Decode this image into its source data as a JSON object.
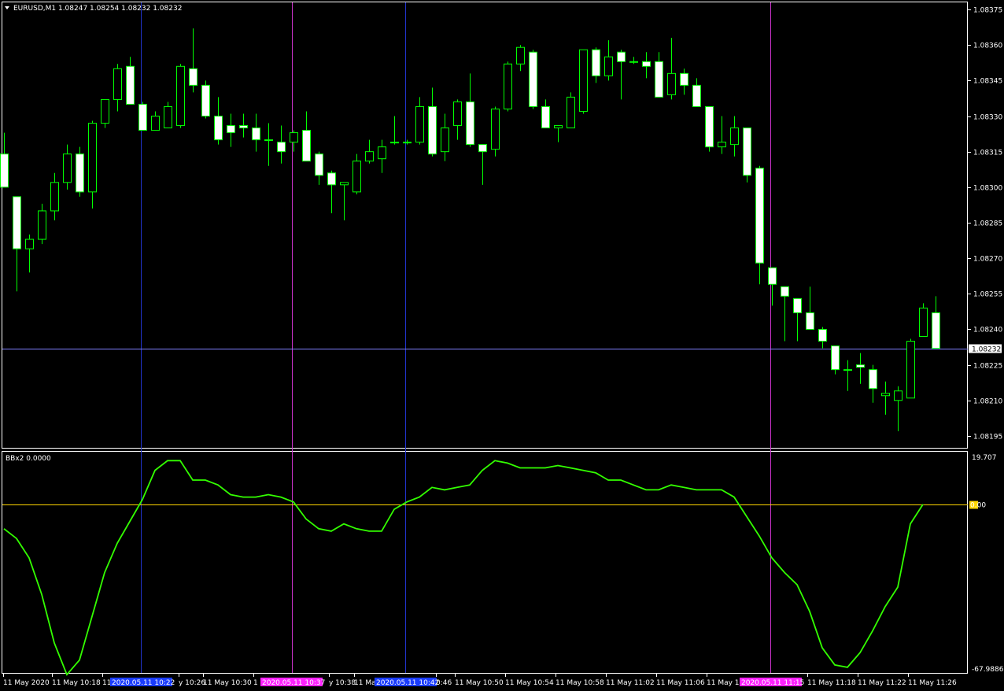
{
  "symbol_header": "EURUSD,M1  1.08247 1.08254 1.08232 1.08232",
  "indicator_header": "BBx2 0.0000",
  "current_price_label": "1.08232",
  "colors": {
    "background": "#000000",
    "frame": "#ffffff",
    "bull_candle": "#00ff00",
    "bear_candle_fill": "#ffffff",
    "indicator_line": "#33ff00",
    "zero_line": "#ffd700",
    "price_line": "#8080ff",
    "vline_blue": "#2233cc",
    "vline_magenta": "#cc33cc",
    "marker_blue": "#1a3cff",
    "marker_magenta": "#ff22ff",
    "zero_badge": "#ffd700"
  },
  "chart_data": [
    {
      "type": "candlestick",
      "title": "EURUSD,M1",
      "ylim": [
        1.0819,
        1.08378
      ],
      "y_ticks": [
        "1.08375",
        "1.08360",
        "1.08345",
        "1.08330",
        "1.08315",
        "1.08300",
        "1.08285",
        "1.08270",
        "1.08255",
        "1.08240",
        "1.08225",
        "1.08210",
        "1.08195"
      ],
      "last_price": 1.08232,
      "candles": [
        {
          "o": 1.08314,
          "h": 1.08323,
          "l": 1.08301,
          "c": 1.083
        },
        {
          "o": 1.08296,
          "h": 1.08296,
          "l": 1.08256,
          "c": 1.08274
        },
        {
          "o": 1.08274,
          "h": 1.0828,
          "l": 1.08264,
          "c": 1.08278
        },
        {
          "o": 1.08278,
          "h": 1.08293,
          "l": 1.08276,
          "c": 1.0829
        },
        {
          "o": 1.0829,
          "h": 1.08306,
          "l": 1.08286,
          "c": 1.08302
        },
        {
          "o": 1.08302,
          "h": 1.08318,
          "l": 1.08299,
          "c": 1.08314
        },
        {
          "o": 1.08314,
          "h": 1.08317,
          "l": 1.08296,
          "c": 1.08298
        },
        {
          "o": 1.08298,
          "h": 1.08328,
          "l": 1.08291,
          "c": 1.08327
        },
        {
          "o": 1.08327,
          "h": 1.08337,
          "l": 1.08325,
          "c": 1.08337
        },
        {
          "o": 1.08337,
          "h": 1.08352,
          "l": 1.08332,
          "c": 1.0835
        },
        {
          "o": 1.08351,
          "h": 1.08355,
          "l": 1.08335,
          "c": 1.08335
        },
        {
          "o": 1.08335,
          "h": 1.08336,
          "l": 1.08325,
          "c": 1.08324
        },
        {
          "o": 1.08324,
          "h": 1.08332,
          "l": 1.08324,
          "c": 1.0833
        },
        {
          "o": 1.08325,
          "h": 1.08336,
          "l": 1.08326,
          "c": 1.08334
        },
        {
          "o": 1.08326,
          "h": 1.08352,
          "l": 1.08325,
          "c": 1.08351
        },
        {
          "o": 1.0835,
          "h": 1.08367,
          "l": 1.0834,
          "c": 1.08343
        },
        {
          "o": 1.08343,
          "h": 1.08345,
          "l": 1.08329,
          "c": 1.0833
        },
        {
          "o": 1.0833,
          "h": 1.08338,
          "l": 1.08318,
          "c": 1.0832
        },
        {
          "o": 1.08326,
          "h": 1.08331,
          "l": 1.08317,
          "c": 1.08323
        },
        {
          "o": 1.08326,
          "h": 1.08331,
          "l": 1.08321,
          "c": 1.08325
        },
        {
          "o": 1.08325,
          "h": 1.08331,
          "l": 1.08315,
          "c": 1.0832
        },
        {
          "o": 1.0832,
          "h": 1.08327,
          "l": 1.08309,
          "c": 1.0832
        },
        {
          "o": 1.08319,
          "h": 1.08326,
          "l": 1.0831,
          "c": 1.08315
        },
        {
          "o": 1.08319,
          "h": 1.08324,
          "l": 1.08315,
          "c": 1.08323
        },
        {
          "o": 1.08324,
          "h": 1.08332,
          "l": 1.08313,
          "c": 1.08311
        },
        {
          "o": 1.08314,
          "h": 1.08315,
          "l": 1.08301,
          "c": 1.08305
        },
        {
          "o": 1.08306,
          "h": 1.08307,
          "l": 1.08289,
          "c": 1.08301
        },
        {
          "o": 1.08301,
          "h": 1.083,
          "l": 1.08286,
          "c": 1.08302
        },
        {
          "o": 1.08298,
          "h": 1.08314,
          "l": 1.08297,
          "c": 1.08311
        },
        {
          "o": 1.08311,
          "h": 1.0832,
          "l": 1.0831,
          "c": 1.08315
        },
        {
          "o": 1.08312,
          "h": 1.0832,
          "l": 1.08306,
          "c": 1.08317
        },
        {
          "o": 1.08319,
          "h": 1.0833,
          "l": 1.08318,
          "c": 1.08319
        },
        {
          "o": 1.08319,
          "h": 1.0832,
          "l": 1.08318,
          "c": 1.08319
        },
        {
          "o": 1.08319,
          "h": 1.08338,
          "l": 1.08318,
          "c": 1.08334
        },
        {
          "o": 1.08334,
          "h": 1.08342,
          "l": 1.08313,
          "c": 1.08314
        },
        {
          "o": 1.08315,
          "h": 1.08331,
          "l": 1.08311,
          "c": 1.08325
        },
        {
          "o": 1.08326,
          "h": 1.08337,
          "l": 1.0832,
          "c": 1.08336
        },
        {
          "o": 1.08336,
          "h": 1.08348,
          "l": 1.08317,
          "c": 1.08318
        },
        {
          "o": 1.08318,
          "h": 1.08317,
          "l": 1.08301,
          "c": 1.08315
        },
        {
          "o": 1.08316,
          "h": 1.08334,
          "l": 1.08313,
          "c": 1.08333
        },
        {
          "o": 1.08333,
          "h": 1.08353,
          "l": 1.08332,
          "c": 1.08352
        },
        {
          "o": 1.08352,
          "h": 1.0836,
          "l": 1.08349,
          "c": 1.08359
        },
        {
          "o": 1.08357,
          "h": 1.08358,
          "l": 1.08333,
          "c": 1.08334
        },
        {
          "o": 1.08334,
          "h": 1.08337,
          "l": 1.08325,
          "c": 1.08325
        },
        {
          "o": 1.08325,
          "h": 1.08326,
          "l": 1.08319,
          "c": 1.08326
        },
        {
          "o": 1.08325,
          "h": 1.0834,
          "l": 1.08325,
          "c": 1.08338
        },
        {
          "o": 1.08332,
          "h": 1.08358,
          "l": 1.08331,
          "c": 1.08358
        },
        {
          "o": 1.08358,
          "h": 1.08359,
          "l": 1.08344,
          "c": 1.08347
        },
        {
          "o": 1.08347,
          "h": 1.08362,
          "l": 1.08345,
          "c": 1.08355
        },
        {
          "o": 1.08357,
          "h": 1.08358,
          "l": 1.08337,
          "c": 1.08353
        },
        {
          "o": 1.08353,
          "h": 1.08355,
          "l": 1.08352,
          "c": 1.08353
        },
        {
          "o": 1.08353,
          "h": 1.08357,
          "l": 1.08346,
          "c": 1.08351
        },
        {
          "o": 1.08353,
          "h": 1.08357,
          "l": 1.08338,
          "c": 1.08338
        },
        {
          "o": 1.08339,
          "h": 1.08363,
          "l": 1.08337,
          "c": 1.08348
        },
        {
          "o": 1.08348,
          "h": 1.0835,
          "l": 1.08339,
          "c": 1.08343
        },
        {
          "o": 1.08343,
          "h": 1.08346,
          "l": 1.08334,
          "c": 1.08334
        },
        {
          "o": 1.08334,
          "h": 1.08334,
          "l": 1.08315,
          "c": 1.08317
        },
        {
          "o": 1.08317,
          "h": 1.0833,
          "l": 1.08314,
          "c": 1.08319
        },
        {
          "o": 1.08318,
          "h": 1.0833,
          "l": 1.08313,
          "c": 1.08325
        },
        {
          "o": 1.08325,
          "h": 1.08325,
          "l": 1.08302,
          "c": 1.08305
        },
        {
          "o": 1.08308,
          "h": 1.08309,
          "l": 1.08259,
          "c": 1.08268
        },
        {
          "o": 1.08266,
          "h": 1.08266,
          "l": 1.0825,
          "c": 1.08259
        },
        {
          "o": 1.08258,
          "h": 1.08258,
          "l": 1.08235,
          "c": 1.08254
        },
        {
          "o": 1.08253,
          "h": 1.08253,
          "l": 1.08235,
          "c": 1.08247
        },
        {
          "o": 1.08247,
          "h": 1.08258,
          "l": 1.0824,
          "c": 1.0824
        },
        {
          "o": 1.0824,
          "h": 1.08241,
          "l": 1.08232,
          "c": 1.08235
        },
        {
          "o": 1.08233,
          "h": 1.08232,
          "l": 1.08221,
          "c": 1.08223
        },
        {
          "o": 1.08223,
          "h": 1.08227,
          "l": 1.08214,
          "c": 1.08223
        },
        {
          "o": 1.08225,
          "h": 1.0823,
          "l": 1.08217,
          "c": 1.08224
        },
        {
          "o": 1.08223,
          "h": 1.08225,
          "l": 1.08209,
          "c": 1.08215
        },
        {
          "o": 1.08212,
          "h": 1.08218,
          "l": 1.08204,
          "c": 1.08213
        },
        {
          "o": 1.0821,
          "h": 1.08216,
          "l": 1.08197,
          "c": 1.08214
        },
        {
          "o": 1.08211,
          "h": 1.08236,
          "l": 1.08212,
          "c": 1.08235
        },
        {
          "o": 1.08237,
          "h": 1.08251,
          "l": 1.08237,
          "c": 1.08249
        },
        {
          "o": 1.08247,
          "h": 1.08254,
          "l": 1.08232,
          "c": 1.08232
        }
      ]
    },
    {
      "type": "line",
      "title": "BBx2",
      "ylim": [
        -67.9886,
        19.707
      ],
      "y_ticks": [
        "19.707",
        "0.00",
        "-67.9886"
      ],
      "zero_level": 0,
      "values": [
        -10,
        -14,
        -22,
        -37,
        -57,
        -70,
        -64,
        -46,
        -28,
        -16,
        -7,
        2,
        14,
        18,
        18,
        10,
        10,
        8,
        4,
        3,
        3,
        4,
        3,
        1,
        -6,
        -10,
        -11,
        -8,
        -10,
        -11,
        -11,
        -2,
        1,
        3,
        7,
        6,
        7,
        8,
        14,
        18,
        17,
        15,
        15,
        15,
        16,
        15,
        14,
        13,
        10,
        10,
        8,
        6,
        6,
        8,
        7,
        6,
        6,
        6,
        3,
        -5,
        -13,
        -22,
        -28,
        -33,
        -44,
        -59,
        -66,
        -67,
        -61,
        -52,
        -42,
        -34,
        -8,
        0
      ]
    }
  ],
  "time_axis": {
    "labels": [
      "11 May 2020",
      "11 May 10:18",
      "11 M",
      "y 10:26",
      "11 May 10:30",
      "1",
      "y 10:38",
      "11 Ma",
      "0:46",
      "11 May 10:50",
      "11 May 10:54",
      "11 May 10:58",
      "11 May 11:02",
      "11 May 11:06",
      "11 May 1",
      "11 May 11:18",
      "11 May 11:22",
      "11 May 11:26"
    ]
  },
  "markers": [
    {
      "text": "2020.05.11 10:22",
      "color": "blue"
    },
    {
      "text": "2020.05.11 10:37",
      "color": "magenta"
    },
    {
      "text": "2020.05.11 10:42",
      "color": "blue"
    },
    {
      "text": "2020.05.11 11:15",
      "color": "magenta"
    }
  ]
}
